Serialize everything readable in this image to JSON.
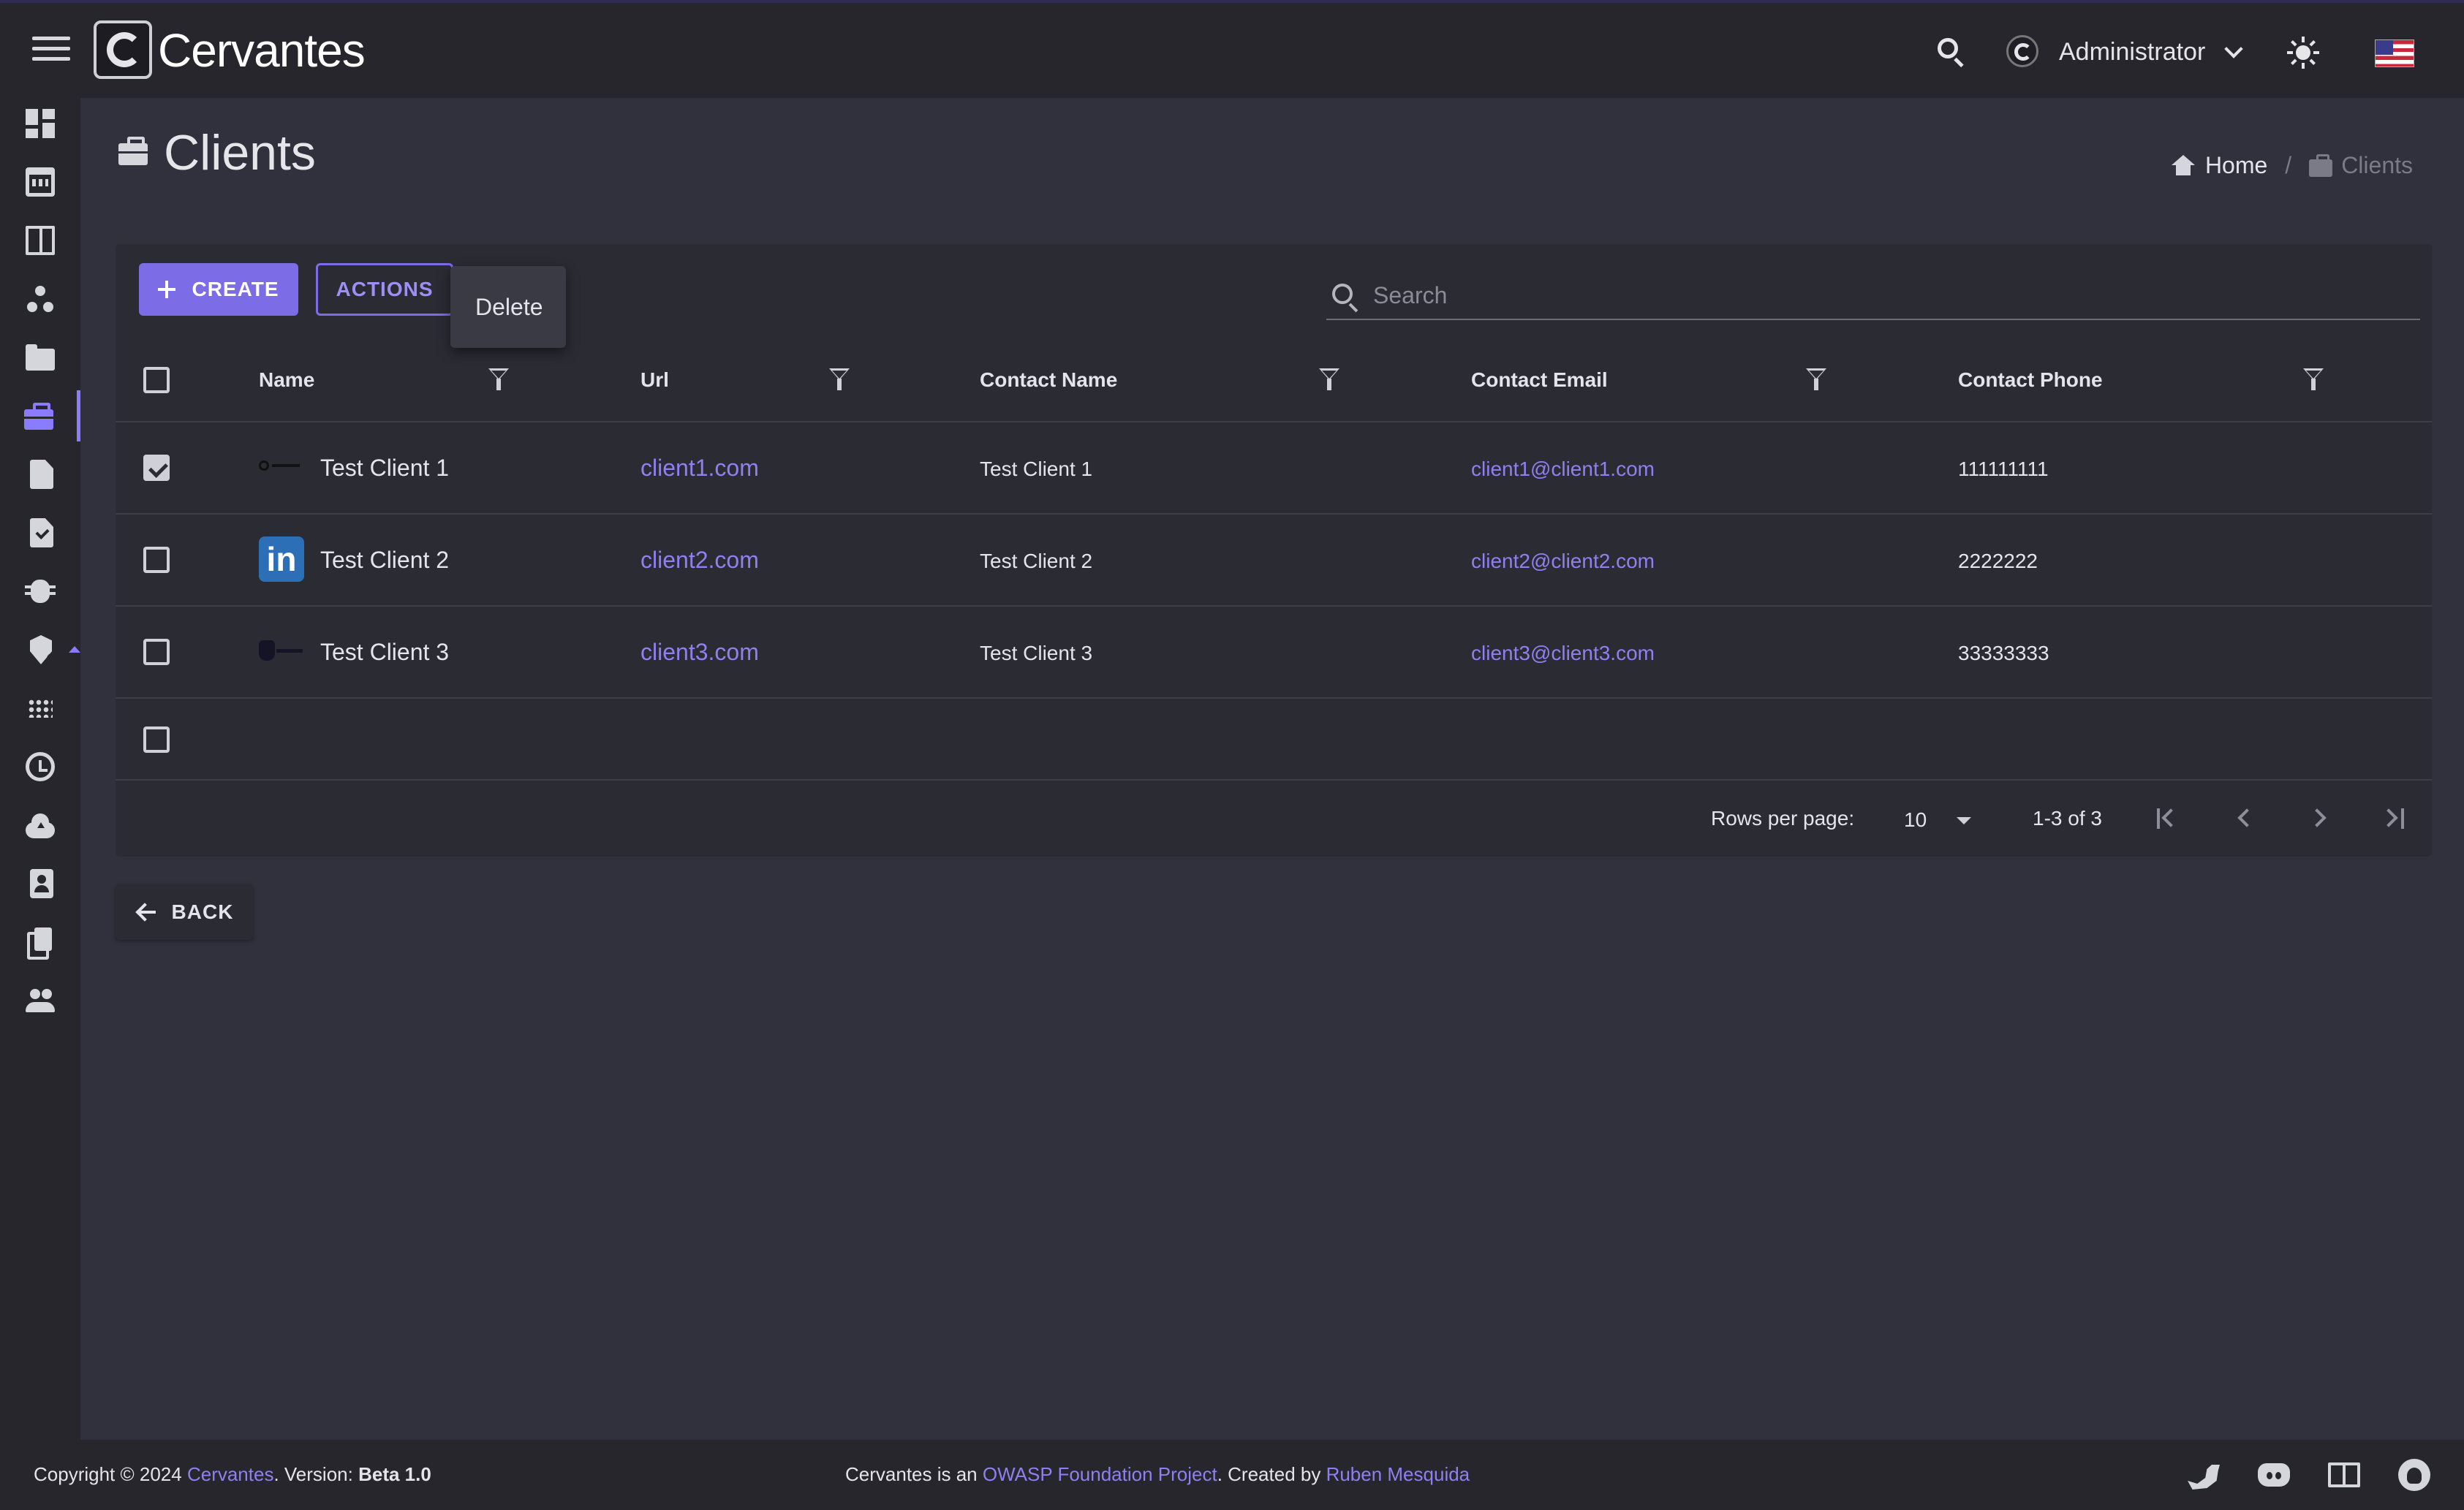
{
  "app": {
    "brand": "Cervantes"
  },
  "topbar": {
    "user_name": "Administrator",
    "icons": [
      "menu-icon",
      "search-icon",
      "avatar",
      "chevron-down-icon",
      "sun-icon",
      "us-flag-icon"
    ]
  },
  "sidebar": {
    "items": [
      {
        "icon": "dashboard-icon"
      },
      {
        "icon": "calendar-icon"
      },
      {
        "icon": "book-icon"
      },
      {
        "icon": "workspaces-icon"
      },
      {
        "icon": "folder-icon"
      },
      {
        "icon": "briefcase-icon",
        "active": true
      },
      {
        "icon": "document-icon"
      },
      {
        "icon": "document-check-icon"
      },
      {
        "icon": "bug-icon"
      },
      {
        "icon": "shield-icon"
      },
      {
        "icon": "apps-icon"
      },
      {
        "icon": "clock-icon"
      },
      {
        "icon": "cloud-upload-icon"
      },
      {
        "icon": "badge-icon"
      },
      {
        "icon": "copy-icon"
      },
      {
        "icon": "people-icon"
      }
    ]
  },
  "page": {
    "title": "Clients"
  },
  "breadcrumb": {
    "home": "Home",
    "separator": "/",
    "current": "Clients"
  },
  "toolbar": {
    "create_label": "CREATE",
    "actions_label": "ACTIONS",
    "menu": {
      "delete_label": "Delete"
    },
    "search_placeholder": "Search"
  },
  "table": {
    "columns": [
      "Name",
      "Url",
      "Contact Name",
      "Contact Email",
      "Contact Phone"
    ],
    "rows": [
      {
        "checked": true,
        "name": "Test Client 1",
        "url": "client1.com",
        "contact_name": "Test Client 1",
        "contact_email": "client1@client1.com",
        "contact_phone": "111111111"
      },
      {
        "checked": false,
        "name": "Test Client 2",
        "logo_text": "in",
        "url": "client2.com",
        "contact_name": "Test Client 2",
        "contact_email": "client2@client2.com",
        "contact_phone": "2222222"
      },
      {
        "checked": false,
        "name": "Test Client 3",
        "url": "client3.com",
        "contact_name": "Test Client 3",
        "contact_email": "client3@client3.com",
        "contact_phone": "33333333"
      }
    ]
  },
  "pagination": {
    "rows_per_page_label": "Rows per page:",
    "rows_per_page": "10",
    "range": "1-3 of 3"
  },
  "back_label": "BACK",
  "footer": {
    "copyright": "Copyright © 2024 ",
    "brand_link": "Cervantes",
    "version_label": ". Version: ",
    "version": "Beta 1.0",
    "center_prefix": "Cervantes is an ",
    "owasp_link": "OWASP Foundation Project",
    "created_by": ". Created by ",
    "author_link": "Ruben Mesquida"
  },
  "colors": {
    "accent": "#7c6ce6",
    "link": "#8e80f0",
    "background": "#31313d",
    "surface": "#2b2b34",
    "bar": "#26262c"
  }
}
